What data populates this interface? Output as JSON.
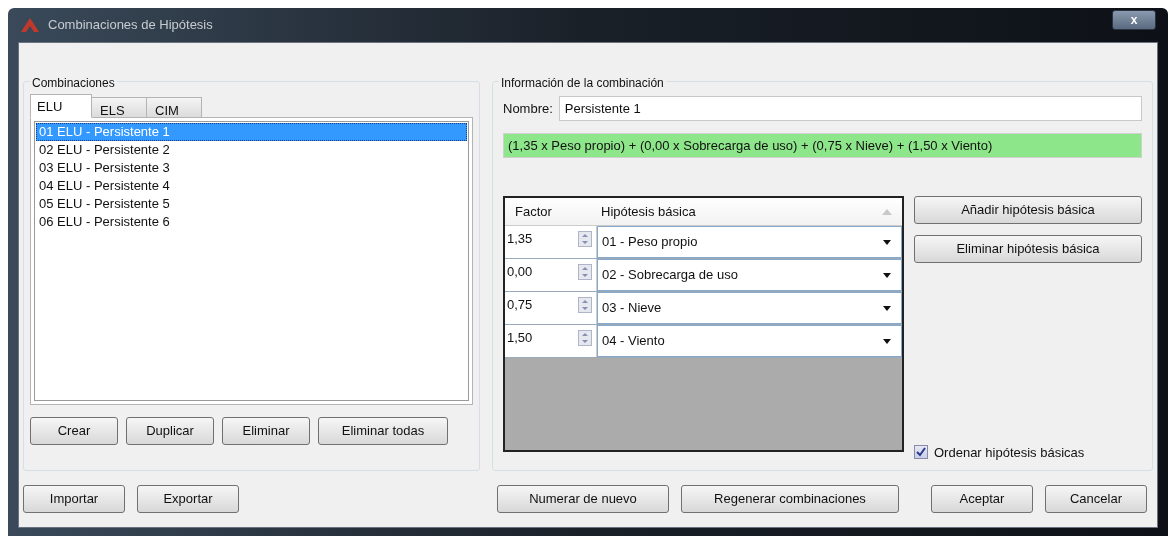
{
  "window": {
    "title": "Combinaciones de Hipótesis",
    "close": "x"
  },
  "combinaciones": {
    "label": "Combinaciones",
    "tabs": [
      {
        "label": "ELU",
        "selected": true
      },
      {
        "label": "ELS",
        "selected": false
      },
      {
        "label": "CIM",
        "selected": false
      }
    ],
    "items": [
      {
        "label": "01 ELU - Persistente 1",
        "selected": true
      },
      {
        "label": "02 ELU - Persistente 2",
        "selected": false
      },
      {
        "label": "03 ELU - Persistente 3",
        "selected": false
      },
      {
        "label": "04 ELU - Persistente 4",
        "selected": false
      },
      {
        "label": "05 ELU - Persistente 5",
        "selected": false
      },
      {
        "label": "06 ELU - Persistente 6",
        "selected": false
      }
    ],
    "buttons": [
      "Crear",
      "Duplicar",
      "Eliminar",
      "Eliminar todas"
    ]
  },
  "informacion": {
    "label": "Información de la combinación",
    "name_label": "Nombre:",
    "name_value": "Persistente 1",
    "formula": "(1,35 x Peso propio) + (0,00 x Sobrecarga de uso) + (0,75 x Nieve) + (1,50 x Viento)",
    "table": {
      "columns": [
        "Factor",
        "Hipótesis básica"
      ],
      "rows": [
        {
          "factor": "1,35",
          "hipotesis": "01 - Peso propio"
        },
        {
          "factor": "0,00",
          "hipotesis": "02 - Sobrecarga de uso"
        },
        {
          "factor": "0,75",
          "hipotesis": "03 - Nieve"
        },
        {
          "factor": "1,50",
          "hipotesis": "04 - Viento"
        }
      ]
    },
    "buttons": [
      "Añadir hipótesis básica",
      "Eliminar hipótesis básica"
    ],
    "sort_checkbox": {
      "label": "Ordenar hipótesis básicas",
      "checked": true
    }
  },
  "footer": {
    "left_buttons": [
      "Importar",
      "Exportar"
    ],
    "middle_buttons": [
      "Numerar de nuevo",
      "Regenerar combinaciones"
    ],
    "right_buttons": [
      "Aceptar",
      "Cancelar"
    ]
  }
}
